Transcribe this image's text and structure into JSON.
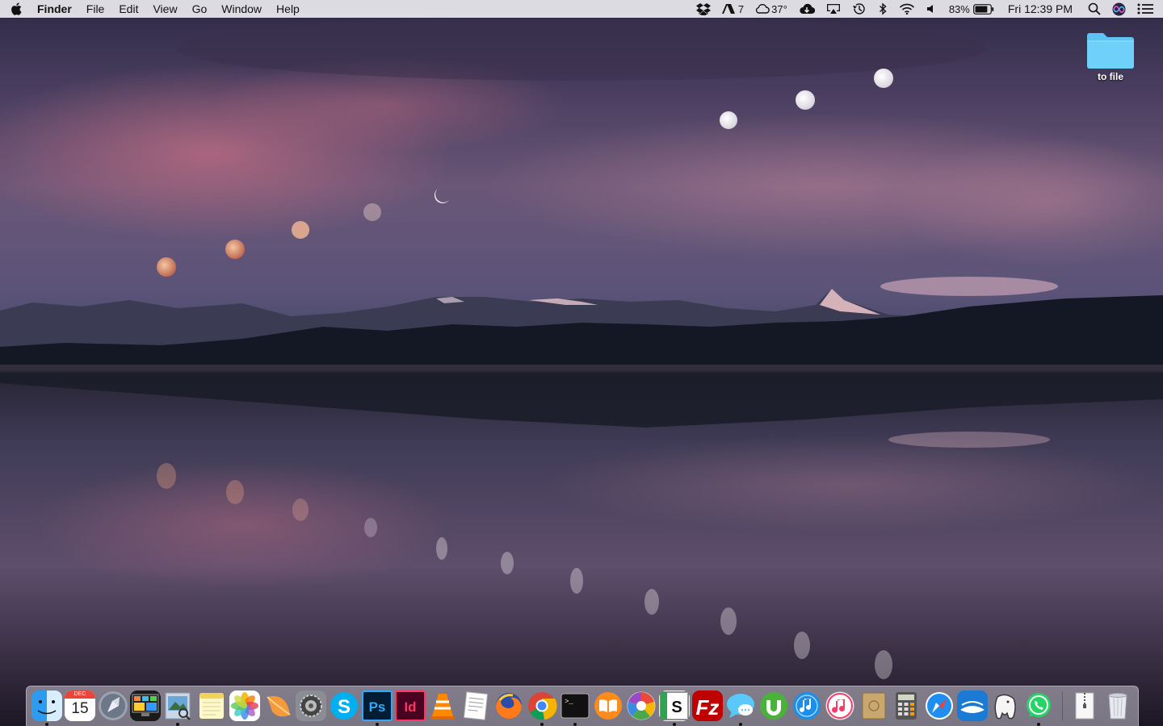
{
  "menubar": {
    "app_name": "Finder",
    "menus": [
      "File",
      "Edit",
      "View",
      "Go",
      "Window",
      "Help"
    ],
    "status": {
      "adobe_count": "7",
      "weather": "37°",
      "battery_percent": "83%",
      "battery_level": 0.83,
      "clock": "Fri 12:39 PM"
    }
  },
  "desktop": {
    "folder_label": "to file",
    "folder_color": "#5ec4f4"
  },
  "dock": {
    "calendar_month": "DEC",
    "calendar_day": "15",
    "apps": [
      {
        "name": "finder",
        "running": true
      },
      {
        "name": "calendar",
        "running": false
      },
      {
        "name": "launchpad",
        "running": false
      },
      {
        "name": "mission-control",
        "running": false
      },
      {
        "name": "preview",
        "running": true
      },
      {
        "name": "notes",
        "running": false
      },
      {
        "name": "photos",
        "running": false
      },
      {
        "name": "mango",
        "running": false
      },
      {
        "name": "system-preferences",
        "running": false
      },
      {
        "name": "skype",
        "running": false
      },
      {
        "name": "photoshop",
        "running": true
      },
      {
        "name": "indesign",
        "running": false
      },
      {
        "name": "vlc",
        "running": false
      },
      {
        "name": "textedit",
        "running": false
      },
      {
        "name": "firefox",
        "running": false
      },
      {
        "name": "chrome",
        "running": true
      },
      {
        "name": "terminal",
        "running": true
      },
      {
        "name": "ibooks",
        "running": false
      },
      {
        "name": "picasa",
        "running": false
      },
      {
        "name": "scrivener",
        "running": true
      },
      {
        "name": "filezilla",
        "running": false
      },
      {
        "name": "messages",
        "running": true
      },
      {
        "name": "utorrent",
        "running": false
      },
      {
        "name": "itunes-connect",
        "running": false
      },
      {
        "name": "itunes",
        "running": false
      },
      {
        "name": "notefile",
        "running": false
      },
      {
        "name": "calculator",
        "running": false
      },
      {
        "name": "safari",
        "running": false
      },
      {
        "name": "kindle",
        "running": false
      },
      {
        "name": "evernote",
        "running": false
      },
      {
        "name": "whatsapp",
        "running": true
      },
      {
        "name": "archive",
        "running": false
      },
      {
        "name": "trash",
        "running": false
      }
    ]
  }
}
